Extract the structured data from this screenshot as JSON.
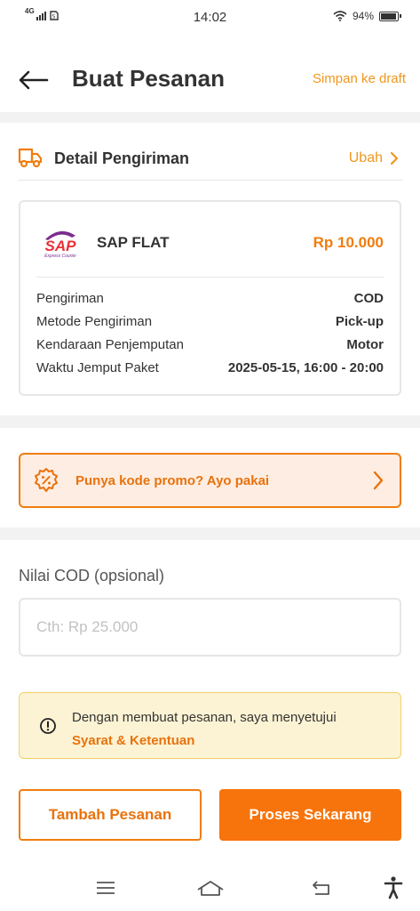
{
  "status_bar": {
    "network": "4G",
    "time": "14:02",
    "battery": "94%",
    "battery_level": 0.94
  },
  "header": {
    "title": "Buat Pesanan",
    "draft_link": "Simpan ke draft"
  },
  "shipping": {
    "section_title": "Detail Pengiriman",
    "edit_label": "Ubah",
    "courier": {
      "logo_text": "SAP",
      "logo_subtext": "Express Courier",
      "name": "SAP FLAT",
      "price": "Rp 10.000"
    },
    "details": [
      {
        "label": "Pengiriman",
        "value": "COD"
      },
      {
        "label": "Metode Pengiriman",
        "value": "Pick-up"
      },
      {
        "label": "Kendaraan Penjemputan",
        "value": "Motor"
      },
      {
        "label": "Waktu Jemput Paket",
        "value": "2025-05-15, 16:00 - 20:00"
      }
    ]
  },
  "promo": {
    "text": "Punya kode promo? Ayo pakai"
  },
  "cod": {
    "label": "Nilai COD (opsional)",
    "value": "",
    "placeholder": "Cth: Rp 25.000"
  },
  "terms": {
    "text": "Dengan membuat pesanan, saya menyetujui",
    "link": "Syarat & Ketentuan"
  },
  "actions": {
    "secondary": "Tambah Pesanan",
    "primary": "Proses Sekarang"
  },
  "colors": {
    "accent": "#F07D0E",
    "link": "#F0971E",
    "promo_bg": "#FEEDE2",
    "terms_bg": "#FCF3D4",
    "logo_purple": "#7B2D8E"
  },
  "nav_bar": {
    "icons": [
      "menu-icon",
      "home-icon",
      "back-icon",
      "accessibility-icon"
    ]
  }
}
